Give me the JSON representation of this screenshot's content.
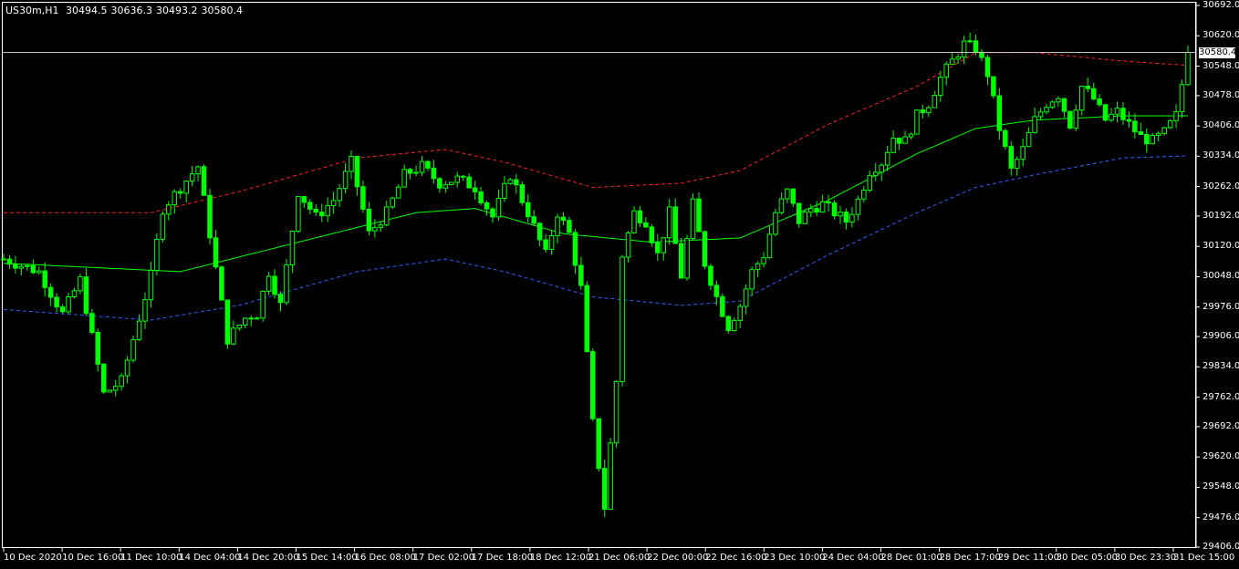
{
  "header": {
    "symbol": "US30m,H1",
    "open": "30494.5",
    "high": "30636.3",
    "low": "30493.2",
    "close": "30580.4"
  },
  "current_price_label": "30580.4",
  "colors": {
    "background": "#000000",
    "candle": "#00ff00",
    "ma_line": "#00ff00",
    "upper_band": "#ff2020",
    "lower_band": "#3060ff",
    "price_line": "#c0c0c0",
    "axis": "#ffffff"
  },
  "chart_data": {
    "type": "candlestick",
    "title": "",
    "symbol": "US30m",
    "timeframe": "H1",
    "y_ticks": [
      "30692.0",
      "30620.0",
      "30548.0",
      "30478.0",
      "30406.0",
      "30334.0",
      "30262.0",
      "30192.0",
      "30120.0",
      "30048.0",
      "29976.0",
      "29906.0",
      "29834.0",
      "29762.0",
      "29692.0",
      "29620.0",
      "29548.0",
      "29476.0",
      "29406.0"
    ],
    "ylim": [
      29406.0,
      30692.0
    ],
    "x_ticks": [
      "10 Dec 2020",
      "10 Dec 16:00",
      "11 Dec 10:00",
      "14 Dec 04:00",
      "14 Dec 20:00",
      "15 Dec 14:00",
      "16 Dec 08:00",
      "17 Dec 02:00",
      "17 Dec 18:00",
      "18 Dec 12:00",
      "21 Dec 06:00",
      "22 Dec 00:00",
      "22 Dec 16:00",
      "23 Dec 10:00",
      "24 Dec 04:00",
      "28 Dec 01:00",
      "28 Dec 17:00",
      "29 Dec 11:00",
      "30 Dec 05:00",
      "30 Dec 23:30",
      "31 Dec 15:00"
    ],
    "current_price": 30580.4,
    "close_path": [
      [
        0,
        30090
      ],
      [
        6,
        30060
      ],
      [
        10,
        29960
      ],
      [
        13,
        30040
      ],
      [
        17,
        29770
      ],
      [
        20,
        29800
      ],
      [
        22,
        29900
      ],
      [
        25,
        30050
      ],
      [
        27,
        30210
      ],
      [
        30,
        30260
      ],
      [
        33,
        30310
      ],
      [
        35,
        30150
      ],
      [
        38,
        29900
      ],
      [
        41,
        29950
      ],
      [
        43,
        29960
      ],
      [
        45,
        30060
      ],
      [
        47,
        29980
      ],
      [
        50,
        30250
      ],
      [
        53,
        30190
      ],
      [
        56,
        30230
      ],
      [
        59,
        30320
      ],
      [
        62,
        30150
      ],
      [
        65,
        30200
      ],
      [
        68,
        30290
      ],
      [
        71,
        30310
      ],
      [
        74,
        30270
      ],
      [
        77,
        30280
      ],
      [
        80,
        30260
      ],
      [
        83,
        30190
      ],
      [
        86,
        30290
      ],
      [
        89,
        30200
      ],
      [
        92,
        30100
      ],
      [
        94,
        30200
      ],
      [
        96,
        30150
      ],
      [
        98,
        30020
      ],
      [
        100,
        29700
      ],
      [
        102,
        29500
      ],
      [
        104,
        29800
      ],
      [
        105,
        30100
      ],
      [
        107,
        30200
      ],
      [
        109,
        30180
      ],
      [
        111,
        30100
      ],
      [
        113,
        30200
      ],
      [
        115,
        30050
      ],
      [
        117,
        30220
      ],
      [
        119,
        30080
      ],
      [
        121,
        30000
      ],
      [
        123,
        29930
      ],
      [
        125,
        29980
      ],
      [
        127,
        30060
      ],
      [
        129,
        30100
      ],
      [
        131,
        30200
      ],
      [
        133,
        30250
      ],
      [
        135,
        30180
      ],
      [
        137,
        30210
      ],
      [
        139,
        30220
      ],
      [
        141,
        30200
      ],
      [
        143,
        30180
      ],
      [
        145,
        30230
      ],
      [
        147,
        30300
      ],
      [
        149,
        30320
      ],
      [
        151,
        30380
      ],
      [
        153,
        30370
      ],
      [
        155,
        30430
      ],
      [
        157,
        30460
      ],
      [
        159,
        30520
      ],
      [
        161,
        30560
      ],
      [
        163,
        30600
      ],
      [
        165,
        30590
      ],
      [
        167,
        30530
      ],
      [
        169,
        30400
      ],
      [
        171,
        30300
      ],
      [
        173,
        30350
      ],
      [
        175,
        30420
      ],
      [
        177,
        30460
      ],
      [
        179,
        30480
      ],
      [
        181,
        30410
      ],
      [
        183,
        30500
      ],
      [
        185,
        30470
      ],
      [
        187,
        30420
      ],
      [
        189,
        30440
      ],
      [
        191,
        30410
      ],
      [
        193,
        30380
      ],
      [
        195,
        30370
      ],
      [
        197,
        30390
      ],
      [
        199,
        30430
      ],
      [
        201,
        30580
      ]
    ],
    "ma": [
      [
        0,
        30080
      ],
      [
        30,
        30060
      ],
      [
        50,
        30130
      ],
      [
        70,
        30200
      ],
      [
        80,
        30210
      ],
      [
        95,
        30150
      ],
      [
        110,
        30130
      ],
      [
        125,
        30140
      ],
      [
        140,
        30230
      ],
      [
        155,
        30340
      ],
      [
        165,
        30400
      ],
      [
        175,
        30420
      ],
      [
        190,
        30430
      ],
      [
        201,
        30430
      ]
    ],
    "upper_band": [
      [
        0,
        30200
      ],
      [
        25,
        30200
      ],
      [
        40,
        30250
      ],
      [
        60,
        30330
      ],
      [
        75,
        30350
      ],
      [
        85,
        30320
      ],
      [
        100,
        30260
      ],
      [
        115,
        30270
      ],
      [
        125,
        30300
      ],
      [
        140,
        30410
      ],
      [
        155,
        30500
      ],
      [
        165,
        30580
      ],
      [
        175,
        30580
      ],
      [
        190,
        30560
      ],
      [
        201,
        30550
      ]
    ],
    "lower_band": [
      [
        0,
        29970
      ],
      [
        25,
        29945
      ],
      [
        40,
        29980
      ],
      [
        60,
        30060
      ],
      [
        75,
        30090
      ],
      [
        85,
        30060
      ],
      [
        100,
        30000
      ],
      [
        115,
        29980
      ],
      [
        125,
        29990
      ],
      [
        140,
        30100
      ],
      [
        155,
        30200
      ],
      [
        165,
        30260
      ],
      [
        175,
        30290
      ],
      [
        190,
        30330
      ],
      [
        201,
        30335
      ]
    ]
  }
}
